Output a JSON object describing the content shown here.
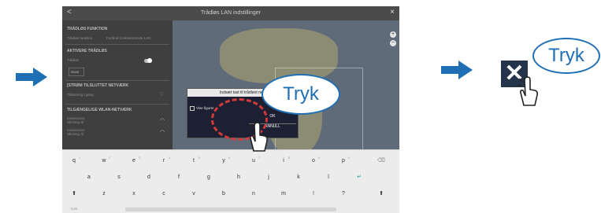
{
  "arrows": {
    "left_icon": "arrow-right",
    "right_icon": "arrow-right",
    "color": "#1f6fb4"
  },
  "screen": {
    "title": "Trådløs LAN indstillinger",
    "back": "<",
    "close": "×",
    "panel": {
      "section_function": "TRÅDLØS FUNKTION",
      "function_label": "Trådløs funktion",
      "function_value": "Forbind til eksisterende LAN",
      "section_activate": "AKTIVERE TRÅDLØS",
      "wireless_label": "Trådløs",
      "scan_label": "Scan",
      "section_connected": "[STRØM TILSLUTTET NETVÆRK",
      "connected_status": "Tilslutning i gang",
      "section_available": "TILGÆNGELIGE WLAN-NETVÆRK",
      "networks": [
        {
          "name": "xxxxxxxxxx",
          "signal": "Skriving af"
        },
        {
          "name": "xxxxxxxxxx",
          "signal": "Skriving af"
        }
      ]
    },
    "map": {
      "zoom_in": "+",
      "zoom_out": "−"
    },
    "dialog": {
      "title": "Indsæt tast til trådløst net",
      "show_chars": "Vise figurer",
      "ok": "OK",
      "cancel": "ANNULL"
    },
    "keyboard": {
      "row1": [
        "q",
        "w",
        "e",
        "r",
        "t",
        "y",
        "u",
        "i",
        "o",
        "p"
      ],
      "row1_hints": [
        "1",
        "2",
        "3",
        "4",
        "5",
        "6",
        "7",
        "8",
        "9",
        "0"
      ],
      "row2": [
        "a",
        "s",
        "d",
        "f",
        "g",
        "h",
        "j",
        "k",
        "l"
      ],
      "row3": [
        "z",
        "x",
        "c",
        "v",
        "b",
        "n",
        "m",
        "!",
        "?"
      ],
      "shift": "⬆",
      "backspace": "⌫",
      "enter": "↵",
      "numbers": "?123"
    }
  },
  "callouts": {
    "tap1": "Tryk",
    "tap2": "Tryk"
  },
  "close_button_symbol": "✕",
  "icons": {
    "hand1": "tap-hand-icon",
    "hand2": "tap-hand-icon"
  }
}
